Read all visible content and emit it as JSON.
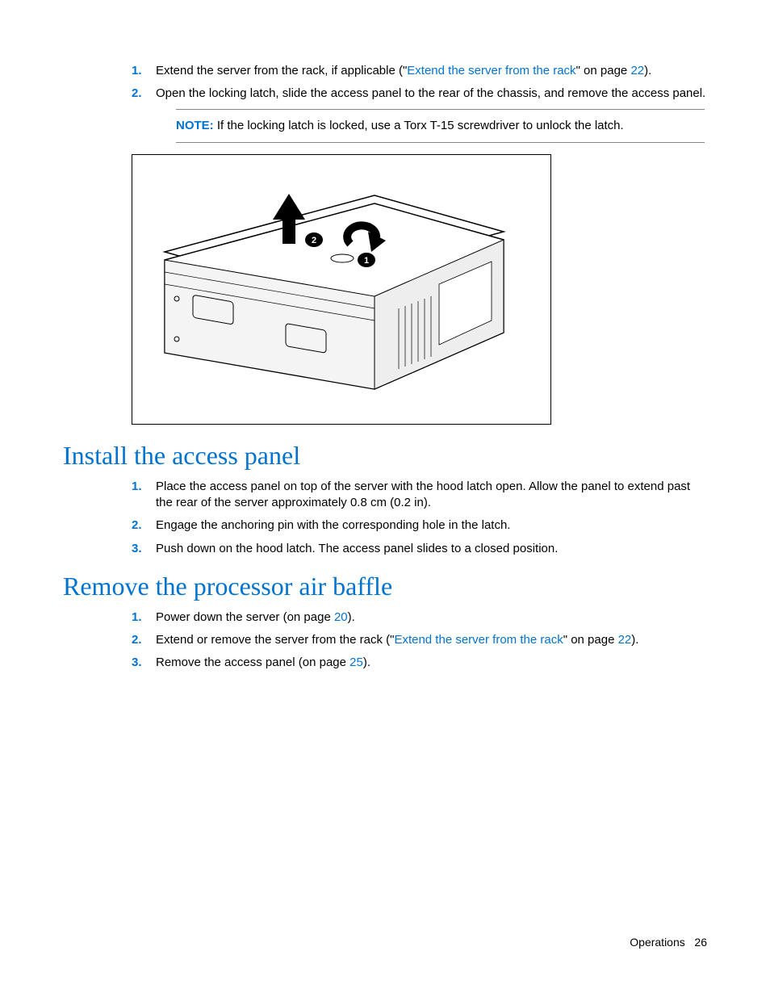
{
  "steps_a": [
    {
      "num": "1.",
      "pre": "Extend the server from the rack, if applicable (\"",
      "link": "Extend the server from the rack",
      "mid": "\" on page ",
      "page_link": "22",
      "post": ")."
    },
    {
      "num": "2.",
      "text": "Open the locking latch, slide the access panel to the rear of the chassis, and remove the access panel."
    }
  ],
  "note": {
    "label": "NOTE:",
    "text": "  If the locking latch is locked, use a Torx T-15 screwdriver to unlock the latch."
  },
  "heading_install": "Install the access panel",
  "steps_install": [
    {
      "num": "1.",
      "text": "Place the access panel on top of the server with the hood latch open. Allow the panel to extend past the rear of the server approximately 0.8 cm (0.2 in)."
    },
    {
      "num": "2.",
      "text": "Engage the anchoring pin with the corresponding hole in the latch."
    },
    {
      "num": "3.",
      "text": "Push down on the hood latch. The access panel slides to a closed position."
    }
  ],
  "heading_remove": "Remove the processor air baffle",
  "steps_remove": [
    {
      "num": "1.",
      "pre": "Power down the server (on page ",
      "page_link": "20",
      "post": ")."
    },
    {
      "num": "2.",
      "pre": "Extend or remove the server from the rack (\"",
      "link": "Extend the server from the rack",
      "mid": "\" on page ",
      "page_link": "22",
      "post": ")."
    },
    {
      "num": "3.",
      "pre": "Remove the access panel (on page ",
      "page_link": "25",
      "post": ")."
    }
  ],
  "footer": {
    "section": "Operations",
    "page": "26"
  }
}
